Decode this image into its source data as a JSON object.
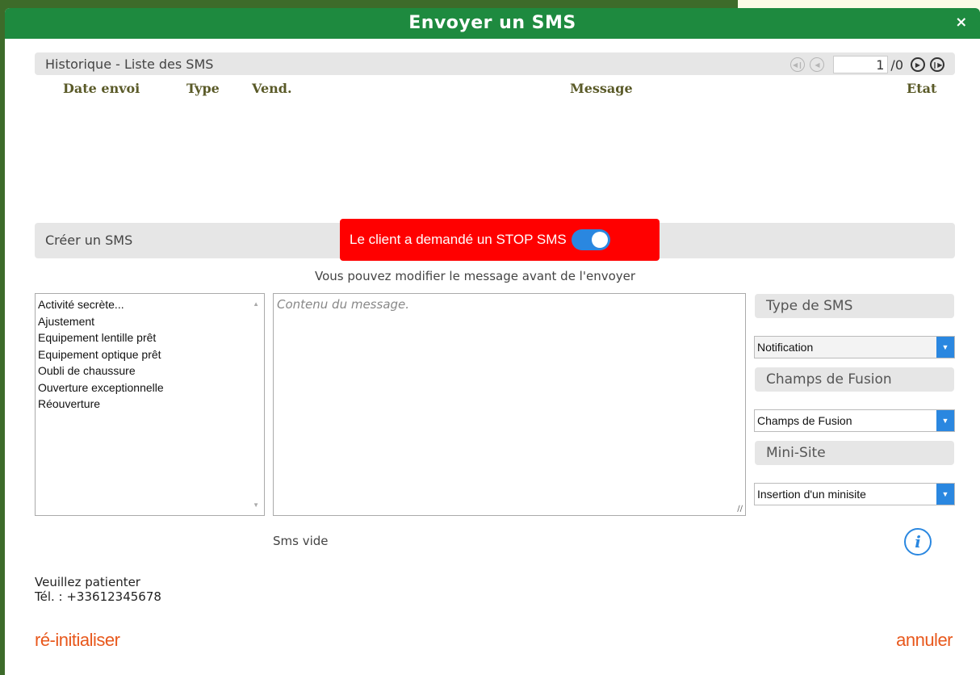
{
  "dialog": {
    "title": "Envoyer un SMS",
    "close_glyph": "×"
  },
  "history": {
    "title": "Historique - Liste des SMS",
    "page_current": "1",
    "page_total": "/0",
    "columns": [
      "Date envoi",
      "Type",
      "Vend.",
      "Message",
      "Etat"
    ],
    "nav_icons": [
      "first-page-icon",
      "prev-page-icon",
      "next-page-icon",
      "last-page-icon"
    ]
  },
  "create": {
    "title": "Créer un SMS",
    "stop_label": "Le client a demandé un STOP SMS",
    "stop_enabled": true,
    "hint": "Vous pouvez modifier le message avant de l'envoyer",
    "templates": [
      "Activité secrète...",
      "Ajustement",
      "Equipement lentille prêt",
      "Equipement optique prêt",
      "Oubli de chaussure",
      "Ouverture exceptionnelle",
      "Réouverture"
    ],
    "message_placeholder": "Contenu du message."
  },
  "side": {
    "type_label": "Type de SMS",
    "type_value": "Notification",
    "fusion_label": "Champs de Fusion",
    "fusion_value": "Champs de Fusion",
    "minisite_label": "Mini-Site",
    "minisite_value": "Insertion d'un minisite"
  },
  "footer": {
    "status": "Sms vide",
    "wait": "Veuillez patienter",
    "phone": "Tél. : +33612345678",
    "reset": "ré-initialiser",
    "cancel": "annuler"
  },
  "colors": {
    "titlebar": "#1e8a3f",
    "stop_bg": "#ff0000",
    "accent_blue": "#2a87e0",
    "link_orange": "#e8581c"
  }
}
